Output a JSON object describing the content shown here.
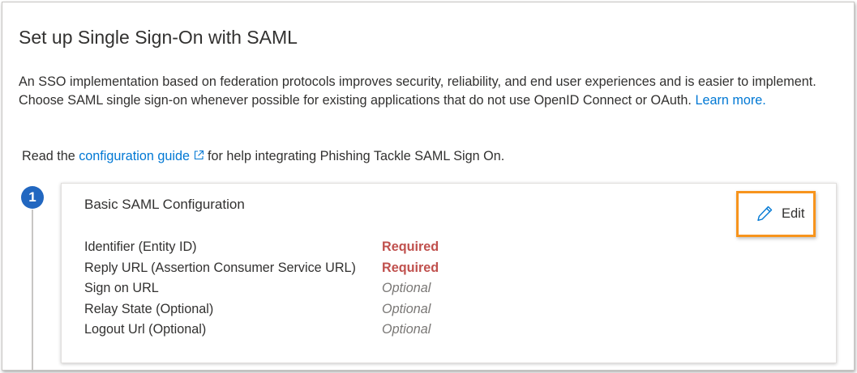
{
  "page": {
    "title": "Set up Single Sign-On with SAML",
    "intro_text": "An SSO implementation based on federation protocols improves security, reliability, and end user experiences and is easier to implement. Choose SAML single sign-on whenever possible for existing applications that do not use OpenID Connect or OAuth.",
    "learn_more": "Learn more.",
    "guide_prefix": "Read the",
    "guide_link": "configuration guide",
    "guide_suffix": "for help integrating Phishing Tackle SAML Sign On."
  },
  "step": {
    "number": "1",
    "card_title": "Basic SAML Configuration",
    "edit_label": "Edit",
    "fields": [
      {
        "label": "Identifier (Entity ID)",
        "value": "Required",
        "status": "required"
      },
      {
        "label": "Reply URL (Assertion Consumer Service URL)",
        "value": "Required",
        "status": "required"
      },
      {
        "label": "Sign on URL",
        "value": "Optional",
        "status": "optional"
      },
      {
        "label": "Relay State (Optional)",
        "value": "Optional",
        "status": "optional"
      },
      {
        "label": "Logout Url (Optional)",
        "value": "Optional",
        "status": "optional"
      }
    ]
  },
  "icons": {
    "edit": "pencil-icon",
    "guide": "external-link-icon"
  },
  "colors": {
    "link": "#0078d4",
    "required": "#c0504d",
    "optional": "#797775",
    "highlight": "#f7941d",
    "step_badge": "#2267c0"
  }
}
